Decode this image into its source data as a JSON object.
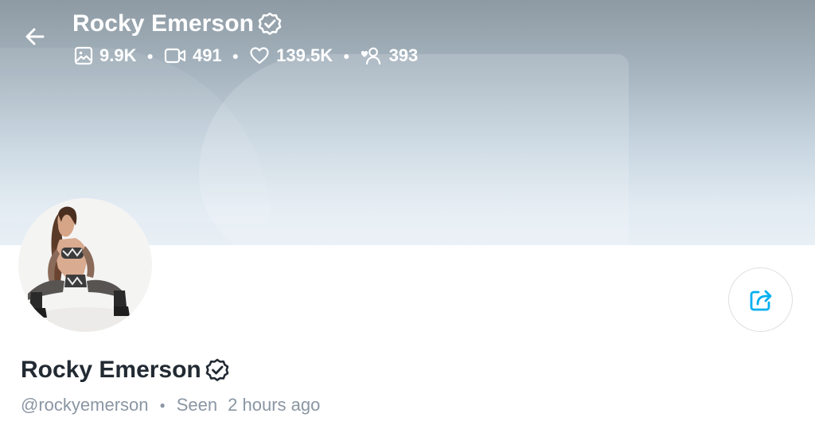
{
  "header": {
    "name": "Rocky Emerson",
    "stats": {
      "photos": "9.9K",
      "videos": "491",
      "likes": "139.5K",
      "fans": "393"
    }
  },
  "icons": {
    "back": "arrow-left-icon",
    "verified": "verified-badge-icon",
    "photos": "image-icon",
    "videos": "video-icon",
    "likes": "heart-icon",
    "fans": "user-heart-icon",
    "share": "share-icon"
  },
  "profile": {
    "name": "Rocky Emerson",
    "handle": "@rockyemerson",
    "seen_label": "Seen",
    "seen_time": "2 hours ago"
  },
  "colors": {
    "accent": "#00aff0",
    "name_text": "#222a33",
    "meta_text": "#8a96a3"
  }
}
